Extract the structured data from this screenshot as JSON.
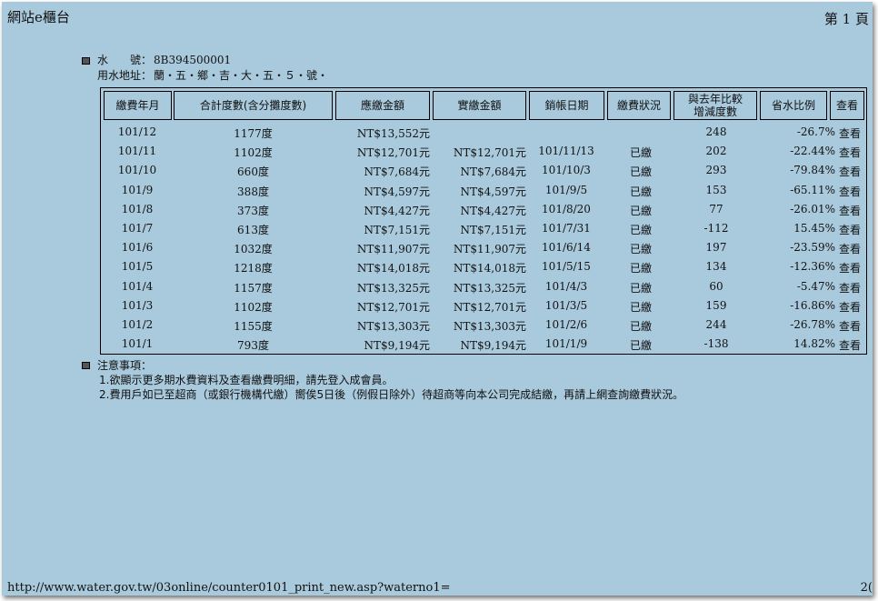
{
  "header": {
    "site_title": "網站e櫃台",
    "page_label": "第 1 頁"
  },
  "account": {
    "water_no_label": "水　　號：",
    "water_no": "8B394500001",
    "address_label": "用水地址：",
    "address": "蘭・五・鄉・吉・大・五・５・號・"
  },
  "table": {
    "headers": [
      "繳費年月",
      "合計度數(含分攤度數)",
      "應繳金額",
      "實繳金額",
      "銷帳日期",
      "繳費狀況",
      "與去年比較\n增減度數",
      "省水比例",
      "查看"
    ],
    "rows": [
      [
        "101/12",
        "1177度",
        "NT$13,552元",
        "",
        "",
        "",
        "248",
        "-26.7%",
        "查看"
      ],
      [
        "101/11",
        "1102度",
        "NT$12,701元",
        "NT$12,701元",
        "101/11/13",
        "已繳",
        "202",
        "-22.44%",
        "查看"
      ],
      [
        "101/10",
        "660度",
        "NT$7,684元",
        "NT$7,684元",
        "101/10/3",
        "已繳",
        "293",
        "-79.84%",
        "查看"
      ],
      [
        "101/9",
        "388度",
        "NT$4,597元",
        "NT$4,597元",
        "101/9/5",
        "已繳",
        "153",
        "-65.11%",
        "查看"
      ],
      [
        "101/8",
        "373度",
        "NT$4,427元",
        "NT$4,427元",
        "101/8/20",
        "已繳",
        "77",
        "-26.01%",
        "查看"
      ],
      [
        "101/7",
        "613度",
        "NT$7,151元",
        "NT$7,151元",
        "101/7/31",
        "已繳",
        "-112",
        "15.45%",
        "查看"
      ],
      [
        "101/6",
        "1032度",
        "NT$11,907元",
        "NT$11,907元",
        "101/6/14",
        "已繳",
        "197",
        "-23.59%",
        "查看"
      ],
      [
        "101/5",
        "1218度",
        "NT$14,018元",
        "NT$14,018元",
        "101/5/15",
        "已繳",
        "134",
        "-12.36%",
        "查看"
      ],
      [
        "101/4",
        "1157度",
        "NT$13,325元",
        "NT$13,325元",
        "101/4/3",
        "已繳",
        "60",
        "-5.47%",
        "查看"
      ],
      [
        "101/3",
        "1102度",
        "NT$12,701元",
        "NT$12,701元",
        "101/3/5",
        "已繳",
        "159",
        "-16.86%",
        "查看"
      ],
      [
        "101/2",
        "1155度",
        "NT$13,303元",
        "NT$13,303元",
        "101/2/6",
        "已繳",
        "244",
        "-26.78%",
        "查看"
      ],
      [
        "101/1",
        "793度",
        "NT$9,194元",
        "NT$9,194元",
        "101/1/9",
        "已繳",
        "-138",
        "14.82%",
        "查看"
      ]
    ]
  },
  "notes": {
    "title": "注意事項：",
    "items": [
      "1.欲顯示更多期水費資料及查看繳費明細，請先登入成會員。",
      "2.費用戶如已至超商（或銀行機構代繳）嚮俟5日後（例假日除外）待超商等向本公司完成結繳，再請上網查詢繳費狀況。"
    ]
  },
  "footer": {
    "url": "http://www.water.gov.tw/03online/counter0101_print_new.asp?waterno1=",
    "right": "2("
  },
  "colors": {
    "page_bg": "#a9c9dc",
    "text": "#111111"
  }
}
